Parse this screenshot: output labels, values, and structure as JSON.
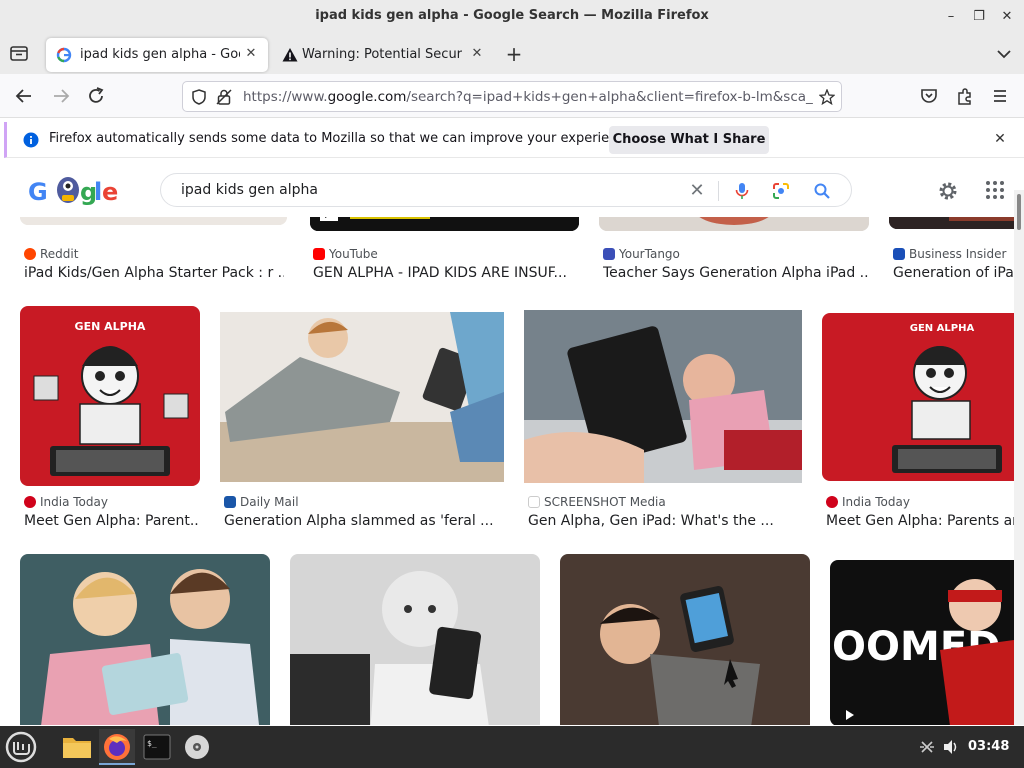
{
  "window": {
    "title": "ipad kids gen alpha - Google Search — Mozilla Firefox",
    "minimize": "–",
    "maximize": "❐",
    "close": "✕"
  },
  "tabs": [
    {
      "label": "ipad kids gen alpha - Google Search",
      "close": "✕",
      "active": true
    },
    {
      "label": "Warning: Potential Security Risk Ahead",
      "close": "✕",
      "active": false
    }
  ],
  "navbar": {
    "url_prefix": "https://www.",
    "url_host": "google.com",
    "url_rest": "/search?q=ipad+kids+gen+alpha&client=firefox-b-lm&sca_esv=a"
  },
  "notification": {
    "message": "Firefox automatically sends some data to Mozilla so that we can improve your experience.",
    "button": "Choose What I Share",
    "close": "✕"
  },
  "google": {
    "query": "ipad kids gen alpha",
    "clear": "✕"
  },
  "results_row1": [
    {
      "source": "Reddit",
      "title": "iPad Kids/Gen Alpha Starter Pack : r ...",
      "icon_color": "#ff4500"
    },
    {
      "source": "YouTube",
      "title": "GEN ALPHA - IPAD KIDS ARE INSUF...",
      "icon_color": "#ff0000"
    },
    {
      "source": "YourTango",
      "title": "Teacher Says Generation Alpha iPad ...",
      "icon_color": "#3b4fb8"
    },
    {
      "source": "Business Insider",
      "title": "Generation of iPad",
      "icon_color": "#1a4fb8"
    }
  ],
  "results_row2": [
    {
      "source": "India Today",
      "title": "Meet Gen Alpha: Parent...",
      "icon_color": "#d0021b",
      "image_text": "GEN ALPHA"
    },
    {
      "source": "Daily Mail",
      "title": "Generation Alpha slammed as 'feral ...",
      "icon_color": "#1a56a8"
    },
    {
      "source": "SCREENSHOT Media",
      "title": "Gen Alpha, Gen iPad: What's the ...",
      "icon_color": "#000000"
    },
    {
      "source": "India Today",
      "title": "Meet Gen Alpha: Parents and",
      "icon_color": "#d0021b",
      "image_text": "GEN ALPHA"
    }
  ],
  "results_row3": [
    {
      "image_text": ""
    },
    {
      "image_text": ""
    },
    {
      "image_text": ""
    },
    {
      "image_text": "OOMED"
    }
  ],
  "taskbar": {
    "clock": "03:48"
  }
}
